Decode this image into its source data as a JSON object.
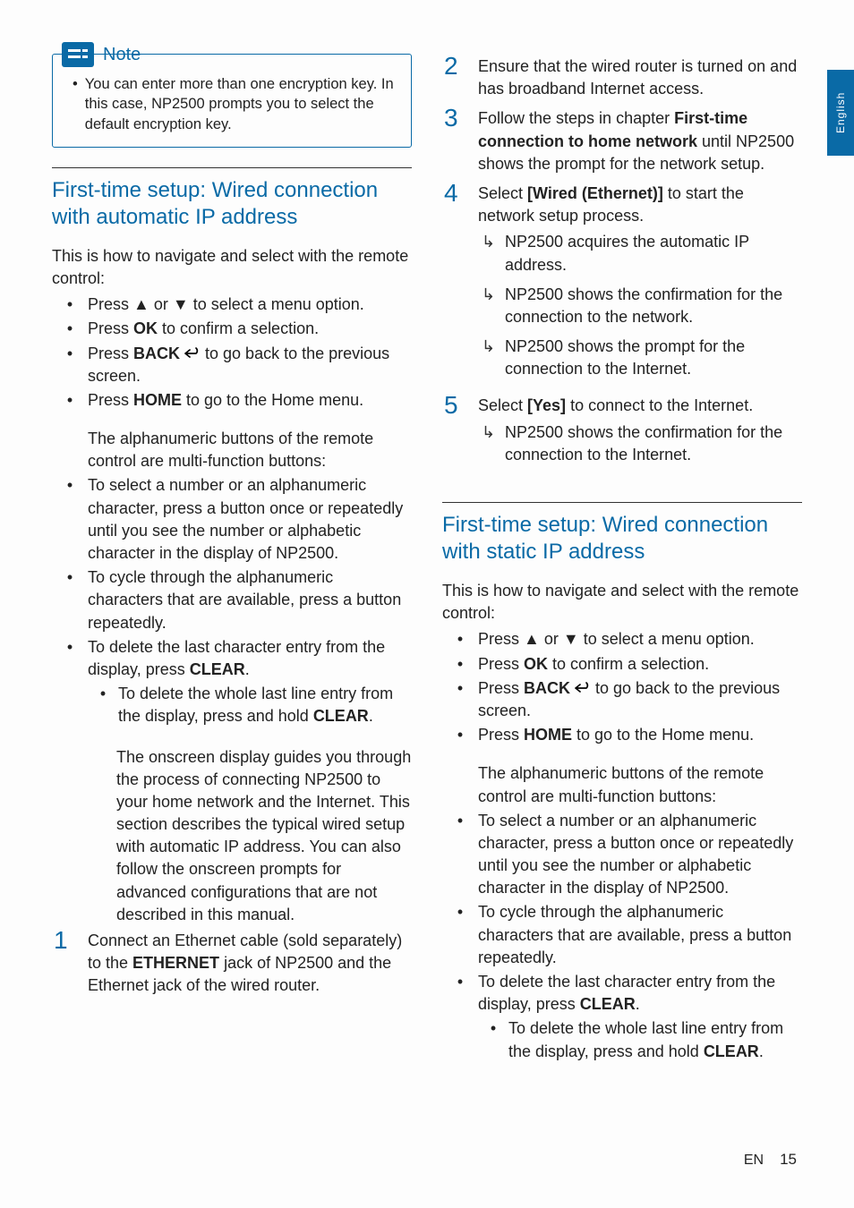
{
  "sideTab": "English",
  "footer": {
    "lang": "EN",
    "page": "15"
  },
  "note": {
    "title": "Note",
    "text": "You can enter more than one encryption key. In this case, NP2500 prompts you to select the default encryption key."
  },
  "left": {
    "heading": "First-time setup: Wired connection with automatic IP address",
    "intro": "This is how to navigate and select with the remote control:",
    "nav": {
      "b1_pre": "Press ",
      "b1_mid": " or ",
      "b1_post": " to select a menu option.",
      "b2_pre": "Press ",
      "b2_bold": "OK",
      "b2_post": " to confirm a selection.",
      "b3_pre": "Press ",
      "b3_bold": "BACK ",
      "b3_post": " to go back to the previous screen.",
      "b4_pre": "Press ",
      "b4_bold": "HOME",
      "b4_post": " to go to the Home menu."
    },
    "alpha_intro": "The alphanumeric buttons of the remote control are multi-function buttons:",
    "alpha": {
      "b1": "To select a number or an alphanumeric character, press a button once or repeatedly until you see the number or alphabetic character in the display of NP2500.",
      "b2": "To cycle through the alphanumeric characters that are available, press a button repeatedly.",
      "b3_pre": "To delete the last character entry from the display, press ",
      "b3_bold": "CLEAR",
      "b3_post": ".",
      "sub_pre": "To delete the whole last line entry from the display, press and hold ",
      "sub_bold": "CLEAR",
      "sub_post": "."
    },
    "guide": "The onscreen display guides you through the process of connecting NP2500 to your home network and the Internet. This section describes the typical wired setup with automatic IP address. You can also follow the onscreen prompts for advanced configurations that are not described in this manual.",
    "step1_pre": "Connect an Ethernet cable (sold separately) to the ",
    "step1_bold": "ETHERNET",
    "step1_post": " jack of NP2500 and the Ethernet jack of the wired router."
  },
  "right": {
    "step2": "Ensure that the wired router is turned on and has broadband Internet access.",
    "step3_pre": "Follow the steps in chapter ",
    "step3_bold": "First-time connection to home network",
    "step3_post": " until NP2500 shows the prompt for the network setup.",
    "step4_pre": "Select ",
    "step4_bold": "[Wired (Ethernet)]",
    "step4_post": " to start the network setup process.",
    "step4_a1": "NP2500 acquires the automatic IP address.",
    "step4_a2": "NP2500 shows the confirmation for the connection to the network.",
    "step4_a3": "NP2500 shows the prompt for the connection to the Internet.",
    "step5_pre": "Select ",
    "step5_bold": "[Yes]",
    "step5_post": " to connect to the Internet.",
    "step5_a1": "NP2500 shows the confirmation for the connection to the Internet.",
    "heading2": "First-time setup: Wired connection with static IP address",
    "intro2": "This is how to navigate and select with the remote control:",
    "nav2": {
      "b1_pre": "Press ",
      "b1_mid": " or ",
      "b1_post": " to select a menu option.",
      "b2_pre": "Press ",
      "b2_bold": "OK",
      "b2_post": " to confirm a selection.",
      "b3_pre": "Press ",
      "b3_bold": "BACK ",
      "b3_post": " to go back to the previous screen.",
      "b4_pre": "Press ",
      "b4_bold": "HOME",
      "b4_post": " to go to the Home menu."
    },
    "alpha_intro2": "The alphanumeric buttons of the remote control are multi-function buttons:",
    "alpha2": {
      "b1": "To select a number or an alphanumeric character, press a button once or repeatedly until you see the number or alphabetic character in the display of NP2500.",
      "b2": "To cycle through the alphanumeric characters that are available, press a button repeatedly.",
      "b3_pre": "To delete the last character entry from the display, press ",
      "b3_bold": "CLEAR",
      "b3_post": ".",
      "sub_pre": "To delete the whole last line entry from the display, press and hold ",
      "sub_bold": "CLEAR",
      "sub_post": "."
    }
  },
  "glyphs": {
    "up": "▲",
    "down": "▼",
    "bullet": "•",
    "step1": "1",
    "step2": "2",
    "step3": "3",
    "step4": "4",
    "step5": "5"
  }
}
